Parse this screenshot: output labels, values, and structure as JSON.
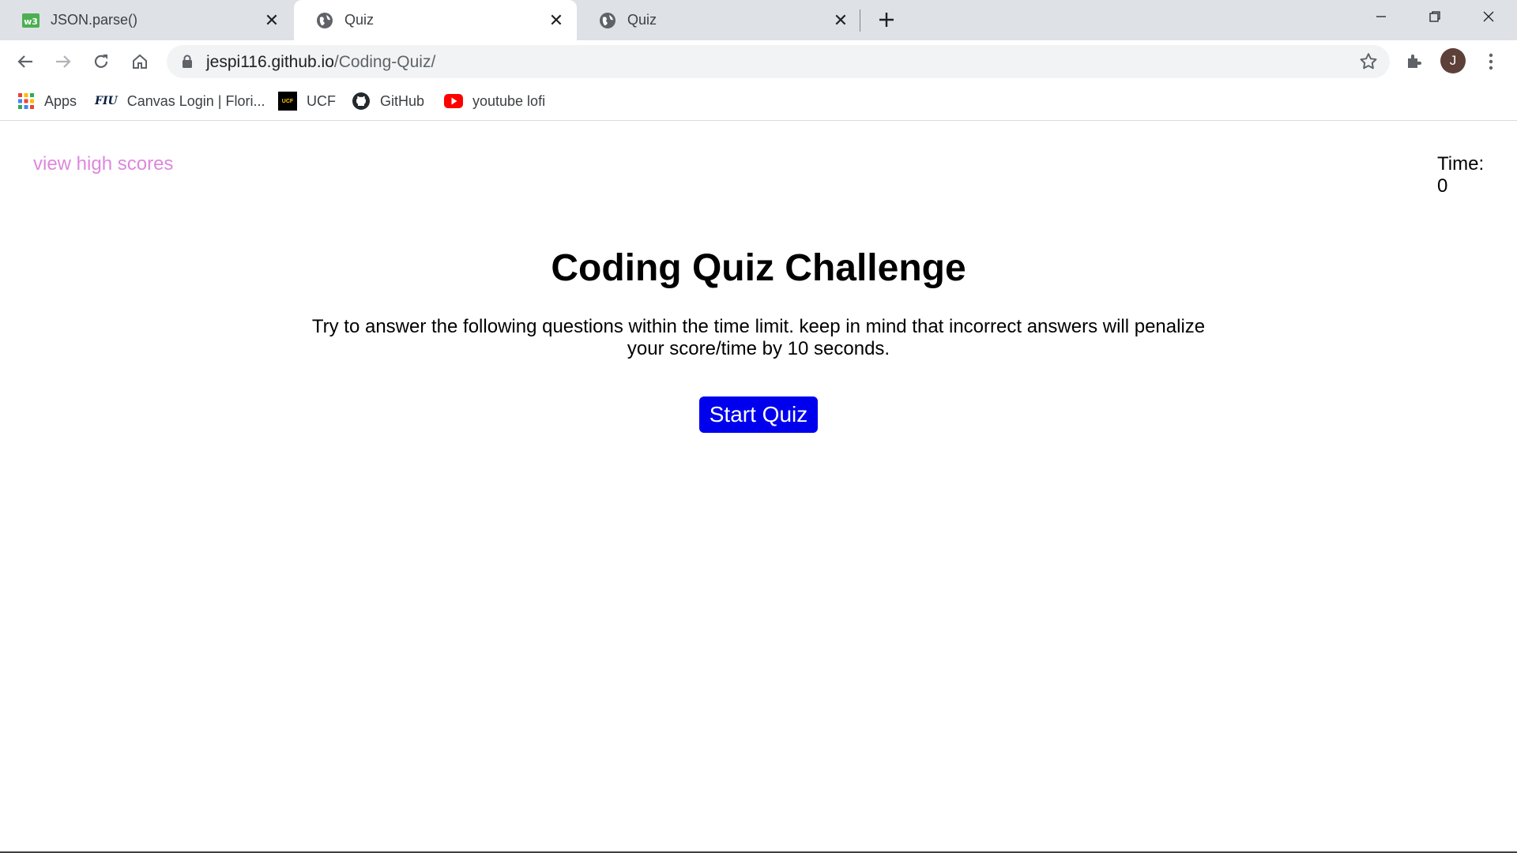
{
  "browser": {
    "tabs": [
      {
        "title": "JSON.parse()",
        "icon": "w3schools-icon",
        "active": false
      },
      {
        "title": "Quiz",
        "icon": "globe-icon",
        "active": true
      },
      {
        "title": "Quiz",
        "icon": "globe-icon",
        "active": false
      }
    ],
    "address": {
      "domain": "jespi116.github.io",
      "path": "/Coding-Quiz/"
    },
    "profile_initial": "J",
    "bookmarks": [
      {
        "label": "Apps",
        "icon": "apps-grid-icon"
      },
      {
        "label": "Canvas Login | Flori...",
        "icon": "fiu-icon",
        "icon_text": "FIU"
      },
      {
        "label": "UCF",
        "icon": "ucf-icon",
        "icon_text": "UCF"
      },
      {
        "label": "GitHub",
        "icon": "github-icon"
      },
      {
        "label": "youtube lofi",
        "icon": "youtube-icon"
      }
    ]
  },
  "page": {
    "high_scores_link": "view high scores",
    "timer_label": "Time:",
    "timer_value": "0",
    "title": "Coding Quiz Challenge",
    "description": "Try to answer the following questions within the time limit. keep in mind that incorrect answers will penalize your score/time by 10 seconds.",
    "start_button": "Start Quiz"
  },
  "colors": {
    "link": "#dd88dd",
    "button": "#0000ee",
    "tabstrip": "#dee1e6"
  }
}
